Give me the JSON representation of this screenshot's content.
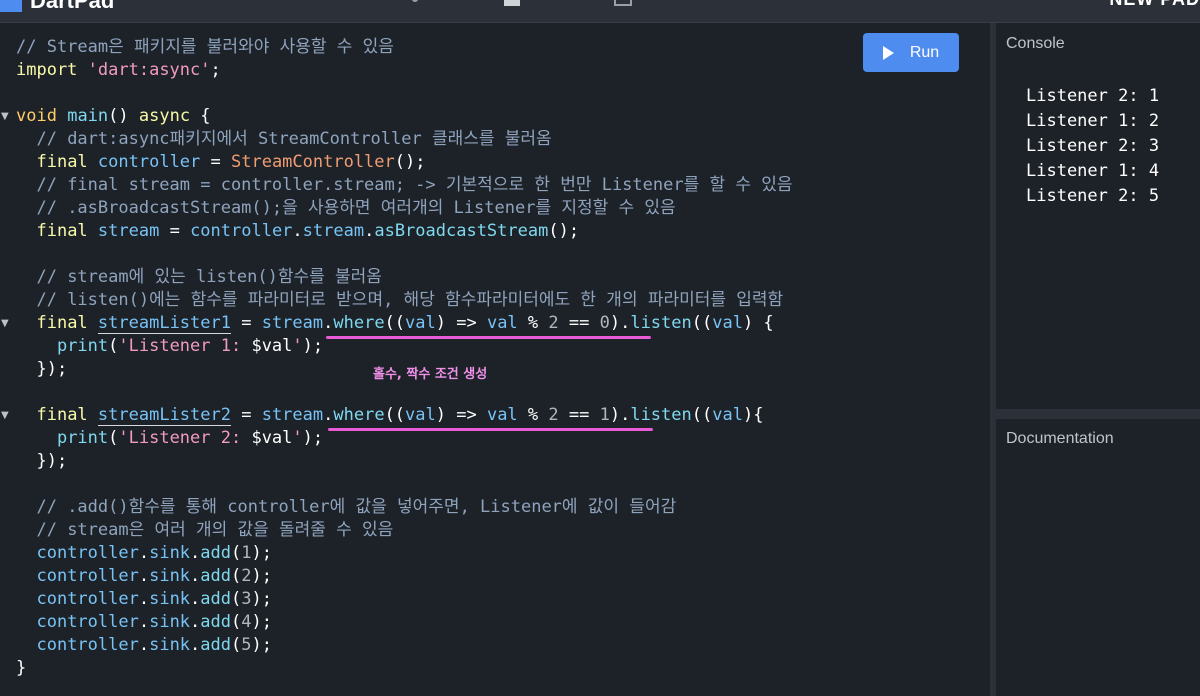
{
  "app": {
    "name": "DartPad",
    "top_right": "NEW PAD"
  },
  "editor": {
    "run_label": "Run",
    "annotation": "홀수, 짝수 조건 생성",
    "lines": [
      [
        [
          "cm",
          "// Stream은 패키지를 불러와야 사용할 수 있음"
        ]
      ],
      [
        [
          "kw",
          "import"
        ],
        [
          "op",
          " "
        ],
        [
          "str",
          "'dart:async'"
        ],
        [
          "op",
          ";"
        ]
      ],
      [],
      [
        [
          "ty",
          "void"
        ],
        [
          "op",
          " "
        ],
        [
          "fn",
          "main"
        ],
        [
          "op",
          "() "
        ],
        [
          "kw",
          "async"
        ],
        [
          "op",
          " {"
        ]
      ],
      [
        [
          "op",
          "  "
        ],
        [
          "cm",
          "// dart:async패키지에서 StreamController 클래스를 불러옴"
        ]
      ],
      [
        [
          "op",
          "  "
        ],
        [
          "kw",
          "final"
        ],
        [
          "op",
          " "
        ],
        [
          "id",
          "controller"
        ],
        [
          "op",
          " = "
        ],
        [
          "cls",
          "StreamController"
        ],
        [
          "op",
          "();"
        ]
      ],
      [
        [
          "op",
          "  "
        ],
        [
          "cm",
          "// final stream = controller.stream; -> 기본적으로 한 번만 Listener를 할 수 있음"
        ]
      ],
      [
        [
          "op",
          "  "
        ],
        [
          "cm",
          "// .asBroadcastStream();을 사용하면 여러개의 Listener를 지정할 수 있음"
        ]
      ],
      [
        [
          "op",
          "  "
        ],
        [
          "kw",
          "final"
        ],
        [
          "op",
          " "
        ],
        [
          "id",
          "stream"
        ],
        [
          "op",
          " = "
        ],
        [
          "id",
          "controller"
        ],
        [
          "op",
          "."
        ],
        [
          "id",
          "stream"
        ],
        [
          "op",
          "."
        ],
        [
          "fn",
          "asBroadcastStream"
        ],
        [
          "op",
          "();"
        ]
      ],
      [],
      [
        [
          "op",
          "  "
        ],
        [
          "cm",
          "// stream에 있는 listen()함수를 불러옴"
        ]
      ],
      [
        [
          "op",
          "  "
        ],
        [
          "cm",
          "// listen()에는 함수를 파라미터로 받으며, 해당 함수파라미터에도 한 개의 파라미터를 입력함"
        ]
      ],
      [
        [
          "op",
          "  "
        ],
        [
          "kw",
          "final"
        ],
        [
          "op",
          " "
        ],
        [
          "id ul",
          "streamLister1"
        ],
        [
          "op",
          " = "
        ],
        [
          "id",
          "stream"
        ],
        [
          "op",
          "."
        ],
        [
          "fn",
          "where"
        ],
        [
          "op",
          "(("
        ],
        [
          "id",
          "val"
        ],
        [
          "op",
          ") => "
        ],
        [
          "id",
          "val"
        ],
        [
          "op",
          " % "
        ],
        [
          "num",
          "2"
        ],
        [
          "op",
          " == "
        ],
        [
          "num",
          "0"
        ],
        [
          "op",
          ")."
        ],
        [
          "fn",
          "listen"
        ],
        [
          "op",
          "(("
        ],
        [
          "id",
          "val"
        ],
        [
          "op",
          ") {"
        ]
      ],
      [
        [
          "op",
          "    "
        ],
        [
          "fn",
          "print"
        ],
        [
          "op",
          "("
        ],
        [
          "str",
          "'Listener 1: "
        ],
        [
          "op",
          "$val"
        ],
        [
          "str",
          "'"
        ],
        [
          "op",
          ");"
        ]
      ],
      [
        [
          "op",
          "  });"
        ]
      ],
      [],
      [
        [
          "op",
          "  "
        ],
        [
          "kw",
          "final"
        ],
        [
          "op",
          " "
        ],
        [
          "id ul",
          "streamLister2"
        ],
        [
          "op",
          " = "
        ],
        [
          "id",
          "stream"
        ],
        [
          "op",
          "."
        ],
        [
          "fn",
          "where"
        ],
        [
          "op",
          "(("
        ],
        [
          "id",
          "val"
        ],
        [
          "op",
          ") => "
        ],
        [
          "id",
          "val"
        ],
        [
          "op",
          " % "
        ],
        [
          "num",
          "2"
        ],
        [
          "op",
          " == "
        ],
        [
          "num",
          "1"
        ],
        [
          "op",
          ")."
        ],
        [
          "fn",
          "listen"
        ],
        [
          "op",
          "(("
        ],
        [
          "id",
          "val"
        ],
        [
          "op",
          "){"
        ]
      ],
      [
        [
          "op",
          "    "
        ],
        [
          "fn",
          "print"
        ],
        [
          "op",
          "("
        ],
        [
          "str",
          "'Listener 2: "
        ],
        [
          "op",
          "$val"
        ],
        [
          "str",
          "'"
        ],
        [
          "op",
          ");"
        ]
      ],
      [
        [
          "op",
          "  });"
        ]
      ],
      [],
      [
        [
          "op",
          "  "
        ],
        [
          "cm",
          "// .add()함수를 통해 controller에 값을 넣어주면, Listener에 값이 들어감"
        ]
      ],
      [
        [
          "op",
          "  "
        ],
        [
          "cm",
          "// stream은 여러 개의 값을 돌려줄 수 있음"
        ]
      ],
      [
        [
          "op",
          "  "
        ],
        [
          "id",
          "controller"
        ],
        [
          "op",
          "."
        ],
        [
          "id",
          "sink"
        ],
        [
          "op",
          "."
        ],
        [
          "fn",
          "add"
        ],
        [
          "op",
          "("
        ],
        [
          "num",
          "1"
        ],
        [
          "op",
          ");"
        ]
      ],
      [
        [
          "op",
          "  "
        ],
        [
          "id",
          "controller"
        ],
        [
          "op",
          "."
        ],
        [
          "id",
          "sink"
        ],
        [
          "op",
          "."
        ],
        [
          "fn",
          "add"
        ],
        [
          "op",
          "("
        ],
        [
          "num",
          "2"
        ],
        [
          "op",
          ");"
        ]
      ],
      [
        [
          "op",
          "  "
        ],
        [
          "id",
          "controller"
        ],
        [
          "op",
          "."
        ],
        [
          "id",
          "sink"
        ],
        [
          "op",
          "."
        ],
        [
          "fn",
          "add"
        ],
        [
          "op",
          "("
        ],
        [
          "num",
          "3"
        ],
        [
          "op",
          ");"
        ]
      ],
      [
        [
          "op",
          "  "
        ],
        [
          "id",
          "controller"
        ],
        [
          "op",
          "."
        ],
        [
          "id",
          "sink"
        ],
        [
          "op",
          "."
        ],
        [
          "fn",
          "add"
        ],
        [
          "op",
          "("
        ],
        [
          "num",
          "4"
        ],
        [
          "op",
          ");"
        ]
      ],
      [
        [
          "op",
          "  "
        ],
        [
          "id",
          "controller"
        ],
        [
          "op",
          "."
        ],
        [
          "id",
          "sink"
        ],
        [
          "op",
          "."
        ],
        [
          "fn",
          "add"
        ],
        [
          "op",
          "("
        ],
        [
          "num",
          "5"
        ],
        [
          "op",
          ");"
        ]
      ],
      [
        [
          "op",
          "}"
        ]
      ]
    ]
  },
  "console": {
    "title": "Console",
    "lines": [
      "Listener 2: 1",
      "Listener 1: 2",
      "Listener 2: 3",
      "Listener 1: 4",
      "Listener 2: 5"
    ]
  },
  "documentation": {
    "title": "Documentation"
  },
  "colors": {
    "accent": "#4f8cf0",
    "highlight": "#e85ad6",
    "editor_bg": "#1d2228"
  }
}
